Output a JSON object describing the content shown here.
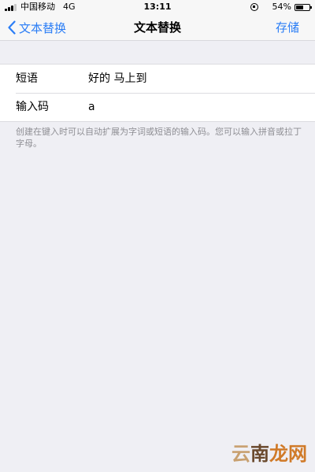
{
  "status_bar": {
    "carrier": "中国移动",
    "network": "4G",
    "time": "13:11",
    "battery_percent": "54%",
    "battery_level": 0.54
  },
  "nav": {
    "back_label": "文本替换",
    "title": "文本替换",
    "save_label": "存储",
    "accent_color": "#2a7df6"
  },
  "form": {
    "rows": [
      {
        "label": "短语",
        "value": "好的 马上到"
      },
      {
        "label": "输入码",
        "value": "a"
      }
    ]
  },
  "footer_note": "创建在键入时可以自动扩展为字词或短语的输入码。您可以输入拼音或拉丁字母。",
  "watermark": {
    "char1": "云",
    "char2": "南",
    "char3": "龙网"
  }
}
